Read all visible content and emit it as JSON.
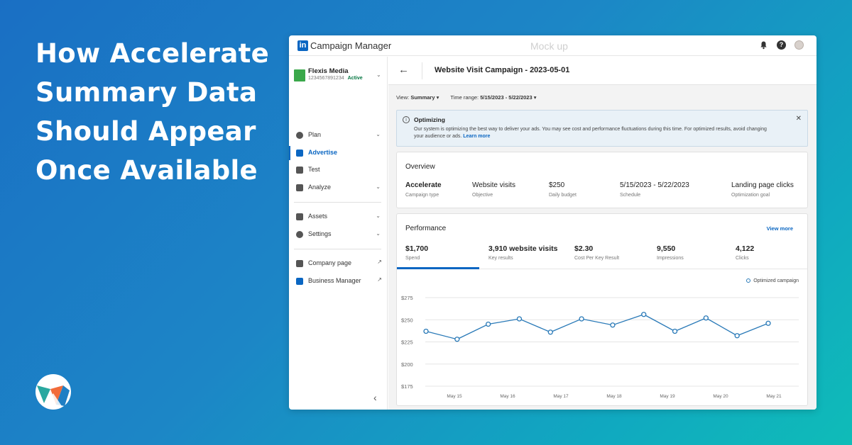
{
  "headline": "How Accelerate Summary Data Should Appear Once Available",
  "topbar": {
    "logo_text": "in",
    "app_title": "Campaign Manager",
    "watermark": "Mock up",
    "icons": [
      "bell-icon",
      "help-icon",
      "avatar"
    ]
  },
  "sidebar": {
    "account": {
      "name": "Flexis Media",
      "id": "1234567891234",
      "status": "Active"
    },
    "items": [
      {
        "label": "Plan",
        "icon": "compass-icon"
      },
      {
        "label": "Advertise",
        "icon": "megaphone-icon",
        "active": true
      },
      {
        "label": "Test",
        "icon": "flask-icon"
      },
      {
        "label": "Analyze",
        "icon": "bar-chart-icon"
      },
      {
        "label": "Assets",
        "icon": "assets-icon"
      },
      {
        "label": "Settings",
        "icon": "gear-icon"
      },
      {
        "label": "Company page",
        "icon": "company-icon"
      },
      {
        "label": "Business Manager",
        "icon": "linkedin-icon"
      }
    ]
  },
  "page": {
    "title": "Website Visit Campaign - 2023-05-01",
    "view_label": "View:",
    "view_value": "Summary",
    "range_label": "Time range:",
    "range_value": "5/15/2023 - 5/22/2023"
  },
  "alert": {
    "title": "Optimizing",
    "body": "Our system is optimizing the best way to  deliver your ads. You may see cost and performance fluctuations during this time. For optimized results, avoid changing your audience or ads.",
    "link": "Learn more"
  },
  "overview": {
    "title": "Overview",
    "items": [
      {
        "value": "Accelerate",
        "label": "Campaign type"
      },
      {
        "value": "Website visits",
        "label": "Objective"
      },
      {
        "value": "$250",
        "label": "Daily budget"
      },
      {
        "value": "5/15/2023 - 5/22/2023",
        "label": "Schedule"
      },
      {
        "value": "Landing page clicks",
        "label": "Optimization goal"
      }
    ]
  },
  "performance": {
    "title": "Performance",
    "view_more": "View more",
    "metrics": [
      {
        "value": "$1,700",
        "label": "Spend"
      },
      {
        "value": "3,910 website visits",
        "label": "Key results"
      },
      {
        "value": "$2.30",
        "label": "Cost Per Key Result"
      },
      {
        "value": "9,550",
        "label": "Impressions"
      },
      {
        "value": "4,122",
        "label": "Clicks"
      }
    ]
  },
  "chart_data": {
    "type": "line",
    "x": [
      "May 15",
      "May 16",
      "May 17",
      "May 18",
      "May 19",
      "May 20",
      "May 21"
    ],
    "yticks": [
      "$275",
      "$250",
      "$225",
      "$200",
      "$175"
    ],
    "ylim": [
      175,
      275
    ],
    "series": [
      {
        "name": "Optimized campaign",
        "color": "#2a7ab8",
        "values": [
          237,
          228,
          245,
          251,
          236,
          251,
          244,
          256,
          237,
          252,
          232,
          246
        ]
      }
    ],
    "grid": true,
    "legend": "top-right"
  }
}
